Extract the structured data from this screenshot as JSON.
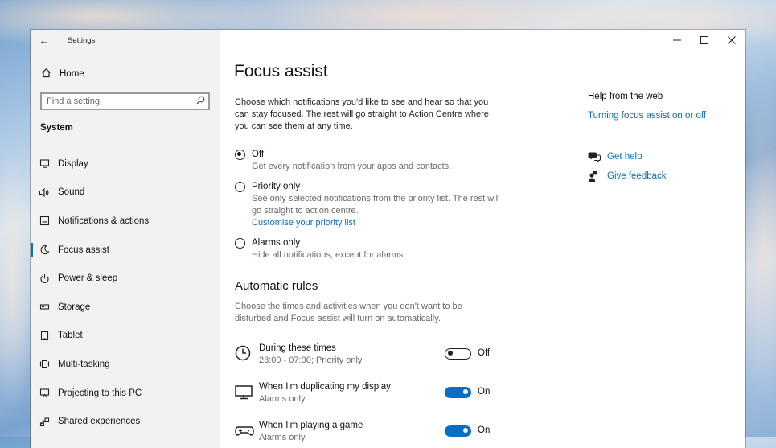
{
  "window": {
    "app_title": "Settings",
    "back_label": "←",
    "controls": {
      "minimize": "—",
      "maximize": "☐",
      "close": "✕"
    }
  },
  "sidebar": {
    "home_label": "Home",
    "search_placeholder": "Find a setting",
    "section_label": "System",
    "items": [
      {
        "label": "Display",
        "icon": "display-icon",
        "active": false
      },
      {
        "label": "Sound",
        "icon": "sound-icon",
        "active": false
      },
      {
        "label": "Notifications & actions",
        "icon": "notifications-icon",
        "active": false
      },
      {
        "label": "Focus assist",
        "icon": "moon-icon",
        "active": true
      },
      {
        "label": "Power & sleep",
        "icon": "power-icon",
        "active": false
      },
      {
        "label": "Storage",
        "icon": "storage-icon",
        "active": false
      },
      {
        "label": "Tablet",
        "icon": "tablet-icon",
        "active": false
      },
      {
        "label": "Multi-tasking",
        "icon": "multitasking-icon",
        "active": false
      },
      {
        "label": "Projecting to this PC",
        "icon": "projecting-icon",
        "active": false
      },
      {
        "label": "Shared experiences",
        "icon": "shared-icon",
        "active": false
      }
    ]
  },
  "main": {
    "title": "Focus assist",
    "description": "Choose which notifications you'd like to see and hear so that you can stay focused. The rest will go straight to Action Centre where you can see them at any time.",
    "options": [
      {
        "label": "Off",
        "sub": "Get every notification from your apps and contacts.",
        "link": "",
        "checked": true
      },
      {
        "label": "Priority only",
        "sub": "See only selected notifications from the priority list. The rest will go straight to action centre.",
        "link": "Customise your priority list",
        "checked": false
      },
      {
        "label": "Alarms only",
        "sub": "Hide all notifications, except for alarms.",
        "link": "",
        "checked": false
      }
    ],
    "rules_title": "Automatic rules",
    "rules_description": "Choose the times and activities when you don't want to be disturbed and Focus assist will turn on automatically.",
    "rules": [
      {
        "title": "During these times",
        "sub": "23:00 - 07:00; Priority only",
        "state": "Off",
        "on": false,
        "icon": "clock-icon"
      },
      {
        "title": "When I'm duplicating my display",
        "sub": "Alarms only",
        "state": "On",
        "on": true,
        "icon": "monitor-icon"
      },
      {
        "title": "When I'm playing a game",
        "sub": "Alarms only",
        "state": "On",
        "on": true,
        "icon": "gamepad-icon"
      }
    ]
  },
  "help": {
    "title": "Help from the web",
    "link": "Turning focus assist on or off",
    "get_help": "Get help",
    "give_feedback": "Give feedback"
  },
  "colors": {
    "accent": "#0a6fc2",
    "sidebar_bg": "#f2f2f2"
  }
}
